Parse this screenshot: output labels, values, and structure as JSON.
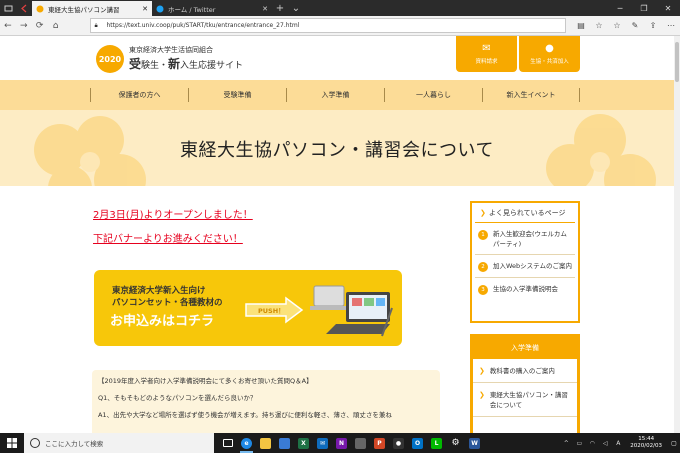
{
  "browser": {
    "tabs": [
      {
        "label": "東経大生協パソコン講習",
        "active": true
      },
      {
        "label": "ホーム / Twitter",
        "active": false
      }
    ],
    "url": "https://text.univ.coop/puk/START/tku/entrance/entrance_27.html"
  },
  "site": {
    "logo": {
      "year": "2020",
      "org": "東京経済大学生活協同組合",
      "name_big1": "受",
      "name_small1": "験生・",
      "name_big2": "新",
      "name_small2": "入生応援サイト"
    },
    "header_buttons": [
      {
        "label": "資料請求",
        "icon": "envelope-icon"
      },
      {
        "label": "生協・共済加入",
        "icon": "person-icon"
      }
    ],
    "gnav": [
      "保護者の方へ",
      "受験準備",
      "入学準備",
      "一人暮らし",
      "新入生イベント"
    ],
    "hero_title": "東経大生協パソコン・講習会について",
    "notice1": "2月3日(月)よりオープンしました！",
    "notice2": "下記バナーよりお進みください！",
    "banner": {
      "line1": "東京経済大学新入生向け",
      "line2": "パソコンセット・各種教材の",
      "line3": "お申込みはコチラ",
      "push": "PUSH！"
    },
    "qa": [
      "【2019年度入学者向け入学準備説明会にて多くお寄せ頂いた質問Q＆A】",
      "Q1、そもそもどのようなパソコンを選んだら良いか？",
      "A1、出先や大学など場所を選ばず使う機会が増えます。持ち運びに便利な軽さ、薄さ、頑丈さを兼ね"
    ],
    "side_popular": {
      "title": "よく見られているページ",
      "items": [
        {
          "num": "1",
          "label": "新入生歓迎会(ウエルカムパーティ)"
        },
        {
          "num": "2",
          "label": "加入Webシステムのご案内"
        },
        {
          "num": "3",
          "label": "生協の入学準備説明会"
        }
      ]
    },
    "side_prep": {
      "title": "入学準備",
      "items": [
        "教科書の購入のご案内",
        "東経大生協パソコン・講習会について"
      ]
    }
  },
  "taskbar": {
    "search_placeholder": "ここに入力して検索",
    "time": "15:44",
    "date": "2020/02/03"
  },
  "colors": {
    "accent": "#f7a900",
    "nav_bg": "#fcdc97",
    "hero_bg": "#fdecc4",
    "notice_red": "#e6001e"
  }
}
